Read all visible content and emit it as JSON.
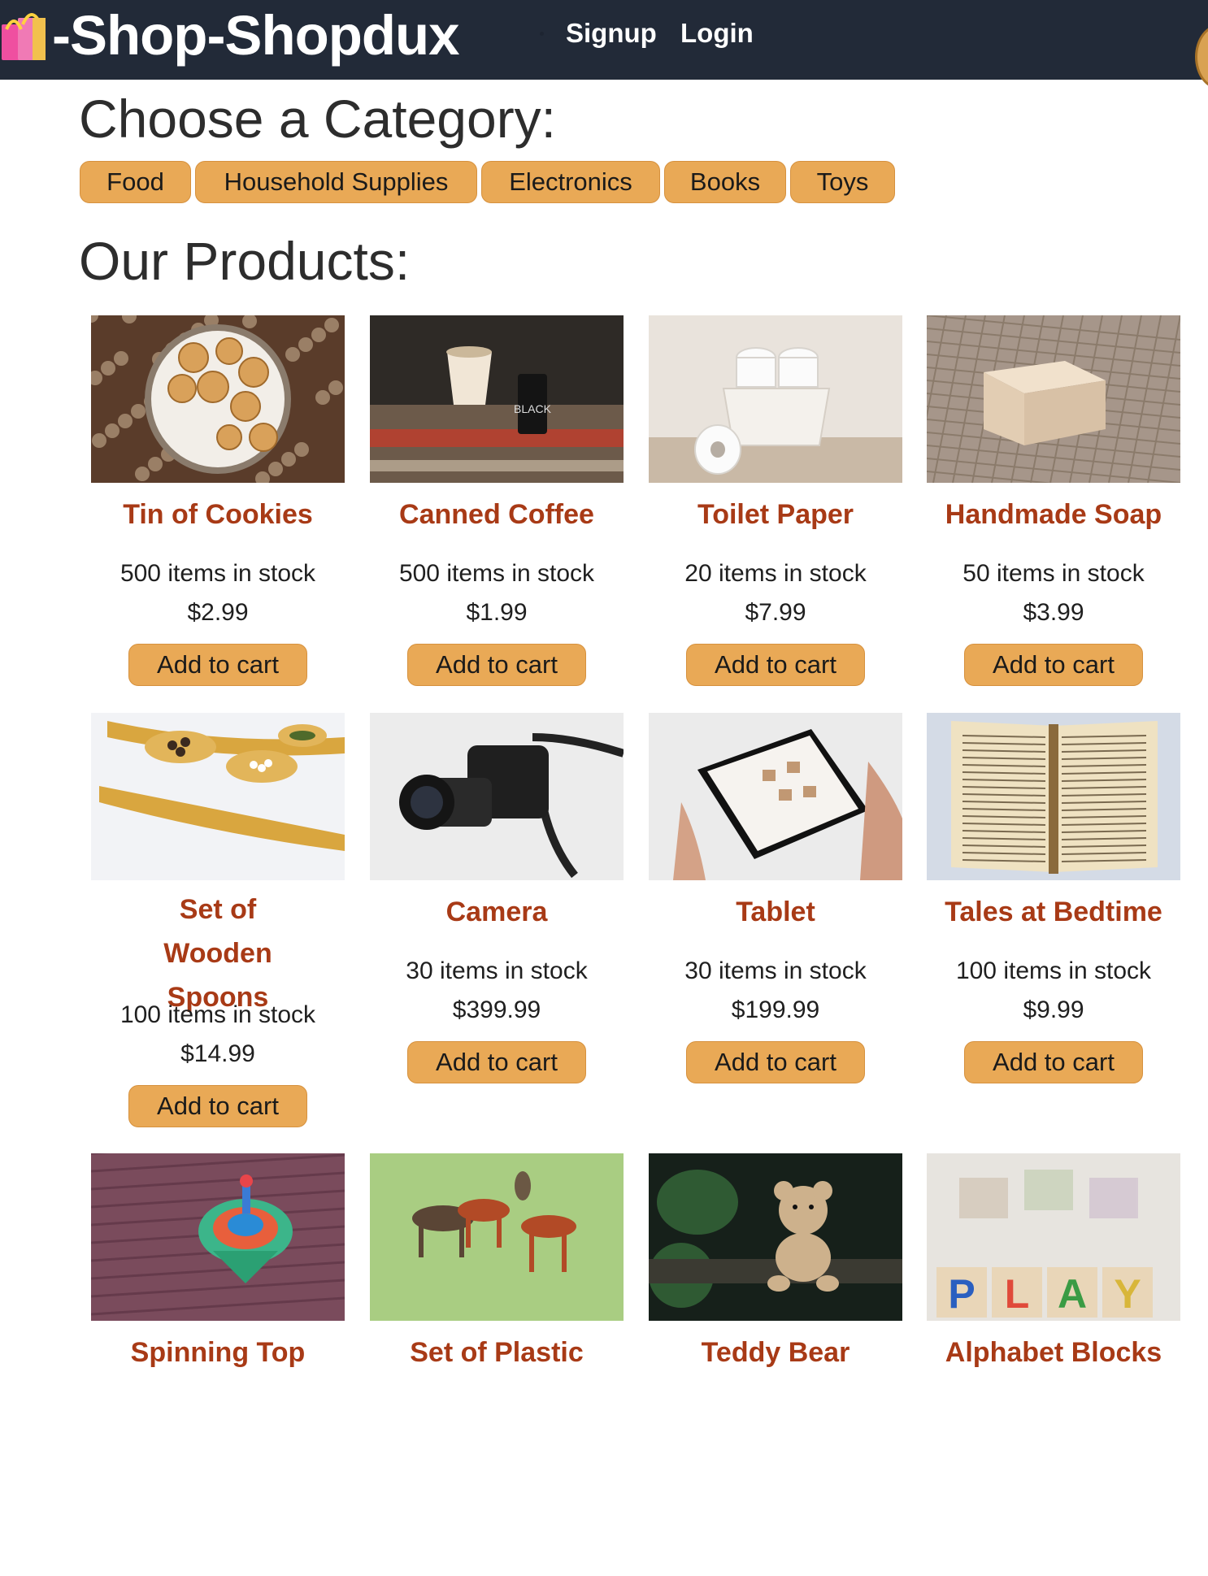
{
  "navbar": {
    "brand": "-Shop-Shopdux",
    "brand_icon": "shopping-bags-icon",
    "links": [
      "Signup",
      "Login"
    ]
  },
  "categories": {
    "title": "Choose a Category:",
    "items": [
      "Food",
      "Household Supplies",
      "Electronics",
      "Books",
      "Toys"
    ]
  },
  "products": {
    "title": "Our Products:",
    "button_label": "Add to cart",
    "items": [
      {
        "name": "Tin of Cookies",
        "stock": "500 items in stock",
        "price": "$2.99",
        "image": "cookies-photo"
      },
      {
        "name": "Canned Coffee",
        "stock": "500 items in stock",
        "price": "$1.99",
        "image": "coffee-photo"
      },
      {
        "name": "Toilet Paper",
        "stock": "20 items in stock",
        "price": "$7.99",
        "image": "toilet-paper-photo"
      },
      {
        "name": "Handmade Soap",
        "stock": "50 items in stock",
        "price": "$3.99",
        "image": "soap-photo"
      },
      {
        "name": "Set of Wooden Spoons",
        "stock": "100 items in stock",
        "price": "$14.99",
        "image": "spoons-photo"
      },
      {
        "name": "Camera",
        "stock": "30 items in stock",
        "price": "$399.99",
        "image": "camera-photo"
      },
      {
        "name": "Tablet",
        "stock": "30 items in stock",
        "price": "$199.99",
        "image": "tablet-photo"
      },
      {
        "name": "Tales at Bedtime",
        "stock": "100 items in stock",
        "price": "$9.99",
        "image": "book-photo"
      },
      {
        "name": "Spinning Top",
        "image": "spinning-top-photo"
      },
      {
        "name": "Set of Plastic",
        "image": "plastic-horses-photo"
      },
      {
        "name": "Teddy Bear",
        "image": "teddy-bear-photo"
      },
      {
        "name": "Alphabet Blocks",
        "image": "alphabet-blocks-photo"
      }
    ]
  },
  "colors": {
    "navbar_bg": "#222a38",
    "accent_button": "#e9a956",
    "product_name": "#a83a16"
  }
}
